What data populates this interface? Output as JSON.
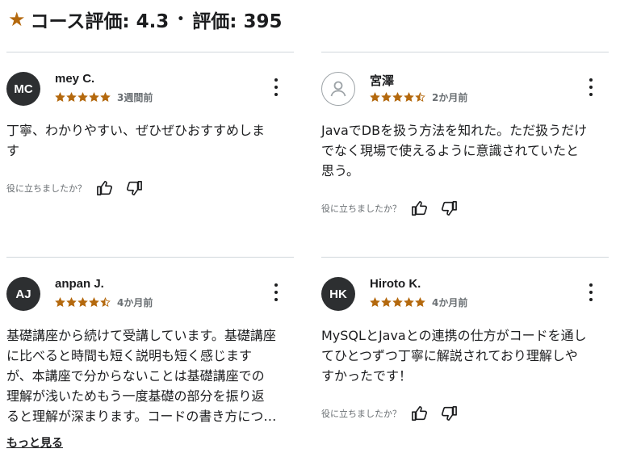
{
  "header": {
    "star": "★",
    "course_rating_label": "コース評価: 4.3",
    "separator": "•",
    "review_count_label": "評価: 395"
  },
  "colors": {
    "star": "#b4690e",
    "avatar_bg": "#2d2f31",
    "rule": "#d1d7dc"
  },
  "helpful_question": "役に立ちましたか？",
  "reviews": [
    {
      "initials": "MC",
      "name": "mey C.",
      "stars": 5,
      "time": "3週間前",
      "text": "丁寧、わかりやすい、ぜひぜひおすすめしま\nす",
      "show_more": ""
    },
    {
      "initials": "",
      "name": "宮澤",
      "stars": 4.5,
      "time": "2か月前",
      "text": "JavaでDBを扱う方法を知れた。ただ扱うだけ\nでなく現場で使えるように意識されていたと\n思う。",
      "show_more": ""
    },
    {
      "initials": "AJ",
      "name": "anpan J.",
      "stars": 4.5,
      "time": "4か月前",
      "text": "基礎講座から続けて受講しています。基礎講座\nに比べると時間も短く説明も短く感じます\nが、本講座で分からないことは基礎講座での\n理解が浅いためもう一度基礎の部分を振り返\nると理解が深まります。コードの書き方につ…",
      "show_more": "もっと見る"
    },
    {
      "initials": "HK",
      "name": "Hiroto K.",
      "stars": 5,
      "time": "4か月前",
      "text": "MySQLとJavaとの連携の仕方がコードを通し\nてひとつずつ丁寧に解説されており理解しや\nすかったです！",
      "show_more": ""
    }
  ]
}
